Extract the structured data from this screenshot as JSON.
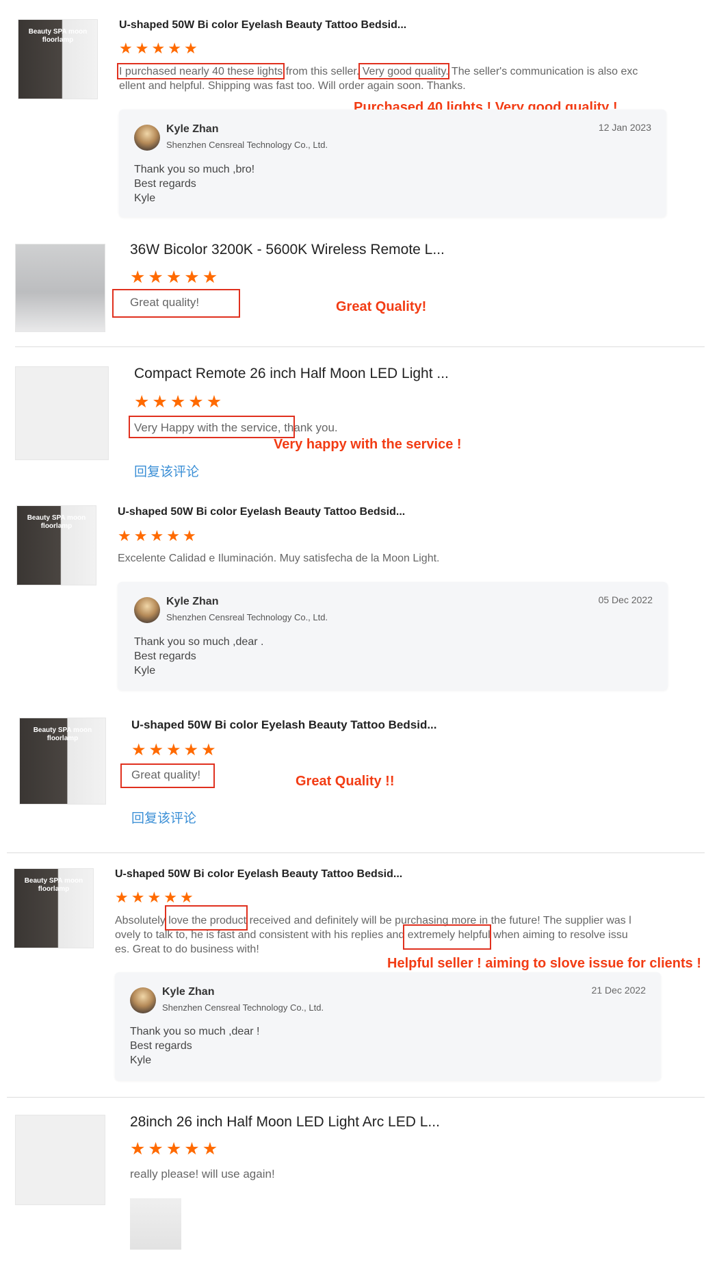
{
  "reviews": [
    {
      "product": "U-shaped 50W Bi color Eyelash Beauty Tattoo Bedsid...",
      "rating": 5,
      "text_parts": [
        "I purchased nearly 40 these lights",
        " from this seller. ",
        "Very good quality.",
        " The seller's communication is also exc",
        "ellent and helpful. Shipping was fast too. Will order again soon. Thanks."
      ],
      "annotation": "Purchased 40 lights !   Very good quality !",
      "thumb_title": "Beauty SPA moon floorlamp",
      "reply": {
        "name": "Kyle Zhan",
        "company": "Shenzhen Censreal Technology Co., Ltd.",
        "date": "12 Jan 2023",
        "lines": [
          "Thank you so much ,bro!",
          "Best regards",
          "Kyle"
        ]
      }
    },
    {
      "product": "36W Bicolor 3200K - 5600K Wireless Remote L...",
      "rating": 5,
      "text": "Great quality!",
      "annotation": "Great Quality!"
    },
    {
      "product": "Compact Remote 26 inch Half Moon LED Light ...",
      "rating": 5,
      "text_parts": [
        "Very Happy with the service,",
        " thank you."
      ],
      "annotation": "Very happy with the service !",
      "reply_link": "回复该评论"
    },
    {
      "product": "U-shaped 50W Bi color Eyelash Beauty Tattoo Bedsid...",
      "rating": 5,
      "text": "Excelente Calidad e Iluminación.  Muy satisfecha de la Moon Light.",
      "thumb_title": "Beauty SPA moon floorlamp",
      "reply": {
        "name": "Kyle Zhan",
        "company": "Shenzhen Censreal Technology Co., Ltd.",
        "date": "05 Dec 2022",
        "lines": [
          "Thank you so much ,dear .",
          "Best regards",
          "Kyle"
        ]
      }
    },
    {
      "product": "U-shaped 50W Bi color Eyelash Beauty Tattoo Bedsid...",
      "rating": 5,
      "text": "Great quality!",
      "annotation": "Great Quality !!",
      "thumb_title": "Beauty SPA moon floorlamp",
      "reply_link": "回复该评论"
    },
    {
      "product": "U-shaped 50W Bi color Eyelash Beauty Tattoo Bedsid...",
      "rating": 5,
      "text_parts": [
        "Absolutely ",
        "love the product",
        " received and definitely will be purchasing more in the future! The supplier was l",
        "ovely to talk to, he is fast and consistent with his replies and ",
        "extremely helpful",
        " when aiming to resolve issu",
        "es. Great to do business with!"
      ],
      "annotation": "Helpful seller ! aiming to slove issue for clients !",
      "thumb_title": "Beauty SPA moon floorlamp",
      "reply": {
        "name": "Kyle Zhan",
        "company": "Shenzhen Censreal Technology Co., Ltd.",
        "date": "21 Dec 2022",
        "lines": [
          "Thank you so much ,dear !",
          "Best regards",
          "Kyle"
        ]
      }
    },
    {
      "product": "28inch 26 inch Half Moon LED Light Arc LED L...",
      "rating": 5,
      "text": "really please! will use again!"
    }
  ],
  "star_glyph": "★★★★★",
  "colors": {
    "star": "#ff6a00",
    "highlight_box": "#e0301e",
    "annotation": "#f23c14",
    "link": "#3b8fd6"
  }
}
